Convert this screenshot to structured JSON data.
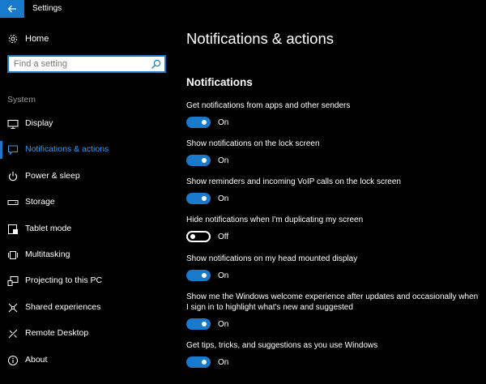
{
  "window": {
    "title": "Settings",
    "accent": "#1979ca"
  },
  "sidebar": {
    "home_label": "Home",
    "search_placeholder": "Find a setting",
    "section_label": "System",
    "items": [
      {
        "label": "Display",
        "icon": "display-icon"
      },
      {
        "label": "Notifications & actions",
        "icon": "notifications-icon",
        "active": true
      },
      {
        "label": "Power & sleep",
        "icon": "power-icon"
      },
      {
        "label": "Storage",
        "icon": "storage-icon"
      },
      {
        "label": "Tablet mode",
        "icon": "tablet-mode-icon"
      },
      {
        "label": "Multitasking",
        "icon": "multitasking-icon"
      },
      {
        "label": "Projecting to this PC",
        "icon": "projecting-icon"
      },
      {
        "label": "Shared experiences",
        "icon": "shared-experiences-icon"
      },
      {
        "label": "Remote Desktop",
        "icon": "remote-desktop-icon"
      },
      {
        "label": "About",
        "icon": "info-icon"
      }
    ]
  },
  "main": {
    "title": "Notifications & actions",
    "section_title": "Notifications",
    "settings": [
      {
        "label": "Get notifications from apps and other senders",
        "state": "On",
        "on": true
      },
      {
        "label": "Show notifications on the lock screen",
        "state": "On",
        "on": true
      },
      {
        "label": "Show reminders and incoming VoIP calls on the lock screen",
        "state": "On",
        "on": true
      },
      {
        "label": "Hide notifications when I'm duplicating my screen",
        "state": "Off",
        "on": false
      },
      {
        "label": "Show notifications on my head mounted display",
        "state": "On",
        "on": true
      },
      {
        "label": "Show me the Windows welcome experience after updates and occasionally when I sign in to highlight what's new and suggested",
        "state": "On",
        "on": true
      },
      {
        "label": "Get tips, tricks, and suggestions as you use Windows",
        "state": "On",
        "on": true
      }
    ]
  }
}
